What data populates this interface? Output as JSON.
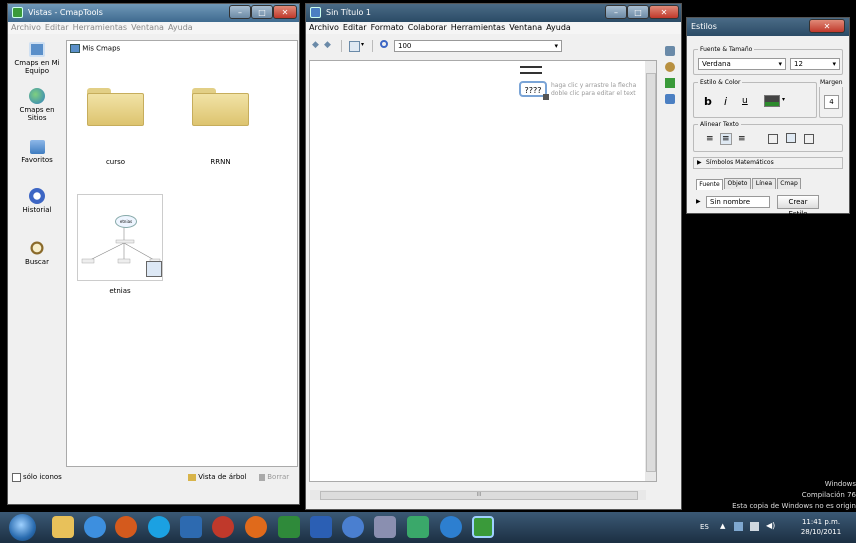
{
  "left_window": {
    "title": "Vistas - CmapTools",
    "menu": [
      "Archivo",
      "Editar",
      "Herramientas",
      "Ventana",
      "Ayuda"
    ],
    "breadcrumb": "Mis Cmaps",
    "sidebar": [
      {
        "label": "Cmaps en Mi Equipo",
        "icon": "computer-icon"
      },
      {
        "label": "Cmaps en Sitios",
        "icon": "globe-icon"
      },
      {
        "label": "Favoritos",
        "icon": "favorites-icon"
      },
      {
        "label": "Historial",
        "icon": "history-icon"
      },
      {
        "label": "Buscar",
        "icon": "search-icon"
      }
    ],
    "items": [
      {
        "label": "curso",
        "type": "folder"
      },
      {
        "label": "RRNN",
        "type": "folder"
      },
      {
        "label": "etnias",
        "type": "cmap"
      }
    ],
    "thumb_node": "etnias",
    "footer": {
      "checkbox": "sólo iconos",
      "tree_view": "Vista de árbol",
      "delete": "Borrar"
    }
  },
  "middle_window": {
    "title": "Sin Título 1",
    "menu": [
      "Archivo",
      "Editar",
      "Formato",
      "Colaborar",
      "Herramientas",
      "Ventana",
      "Ayuda"
    ],
    "zoom": "100",
    "node_text": "????",
    "hint_line1": "haga clic y arrastre la flecha",
    "hint_line2": "doble clic para editar el text",
    "scroll_mid": "III"
  },
  "styles_window": {
    "title": "Estilos",
    "font_group": "Fuente & Tamaño",
    "font": "Verdana",
    "size": "12",
    "style_group": "Estilo & Color",
    "margin_label": "Margen",
    "margin_value": "4",
    "bold": "b",
    "italic": "i",
    "underline": "u",
    "align_group": "Alinear Texto",
    "math": "Símbolos Matemáticos",
    "tabs": [
      "Fuente",
      "Objeto",
      "Línea",
      "Cmap"
    ],
    "style_name": "Sin nombre",
    "create_style": "Crear Estilo"
  },
  "watermark": {
    "line1": "Windows",
    "line2": "Compilación 76",
    "line3": "Esta copia de Windows no es origin"
  },
  "taskbar": {
    "lang": "ES",
    "time": "11:41 p.m.",
    "date": "28/10/2011"
  },
  "colors": {
    "titlebar": "#3f6a8f",
    "taskbar": "#1c2f42",
    "folder": "#ddc46f"
  }
}
